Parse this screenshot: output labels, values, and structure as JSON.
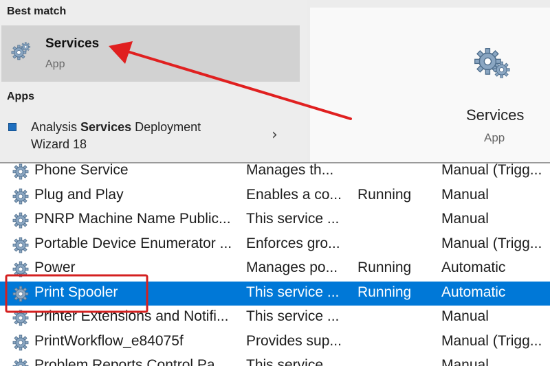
{
  "search": {
    "best_match_heading": "Best match",
    "best_match": {
      "name": "Services",
      "type": "App",
      "icon": "services-gear-icon"
    },
    "apps_heading": "Apps",
    "apps": [
      {
        "label": "Analysis Services Deployment Wizard 18",
        "prefix": "Analysis ",
        "bold": "Services",
        "suffix": " Deployment Wizard 18"
      }
    ],
    "preview": {
      "title": "Services",
      "type": "App",
      "icon": "services-gear-icon"
    }
  },
  "services": [
    {
      "name": "Phone Service",
      "description": "Manages th...",
      "status": "",
      "startup": "Manual (Trigg...",
      "selected": false
    },
    {
      "name": "Plug and Play",
      "description": "Enables a co...",
      "status": "Running",
      "startup": "Manual",
      "selected": false
    },
    {
      "name": "PNRP Machine Name Public...",
      "description": "This service ...",
      "status": "",
      "startup": "Manual",
      "selected": false
    },
    {
      "name": "Portable Device Enumerator ...",
      "description": "Enforces gro...",
      "status": "",
      "startup": "Manual (Trigg...",
      "selected": false
    },
    {
      "name": "Power",
      "description": "Manages po...",
      "status": "Running",
      "startup": "Automatic",
      "selected": false
    },
    {
      "name": "Print Spooler",
      "description": "This service ...",
      "status": "Running",
      "startup": "Automatic",
      "selected": true
    },
    {
      "name": "Printer Extensions and Notifi...",
      "description": "This service ...",
      "status": "",
      "startup": "Manual",
      "selected": false
    },
    {
      "name": "PrintWorkflow_e84075f",
      "description": "Provides sup...",
      "status": "",
      "startup": "Manual (Trigg...",
      "selected": false
    },
    {
      "name": "Problem Reports Control Pa...",
      "description": "This service ...",
      "status": "",
      "startup": "Manual",
      "selected": false
    }
  ],
  "colors": {
    "selection": "#0078d7",
    "annotation": "#e02020",
    "best_match_bg": "#d2d2d2"
  }
}
